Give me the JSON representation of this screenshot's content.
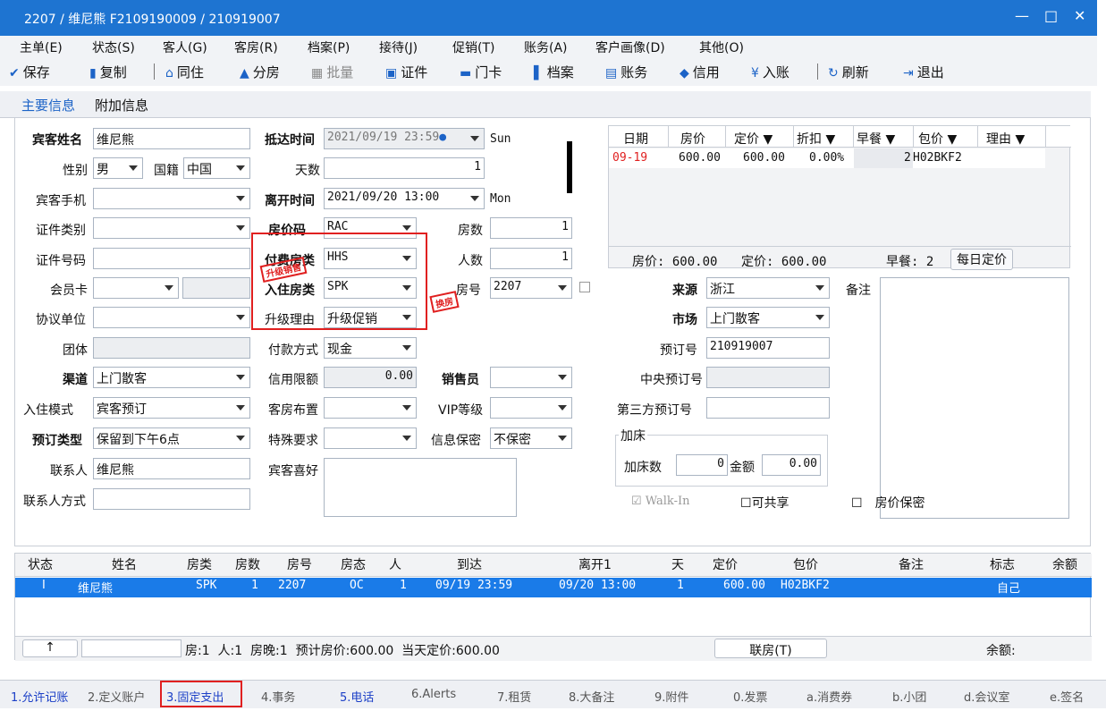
{
  "window": {
    "title": "2207 / 维尼熊 F2109190009 / 210919007",
    "min": "—",
    "max": "□",
    "close": "✕"
  },
  "menu": [
    "主单(E)",
    "状态(S)",
    "客人(G)",
    "客房(R)",
    "档案(P)",
    "接待(J)",
    "促销(T)",
    "账务(A)",
    "客户画像(D)",
    "其他(O)"
  ],
  "toolbar": {
    "save": "保存",
    "copy": "复制",
    "cohabit": "同住",
    "split": "分房",
    "batch": "批量",
    "cert": "证件",
    "card": "门卡",
    "archive": "档案",
    "account": "账务",
    "credit": "信用",
    "post": "入账",
    "refresh": "刷新",
    "exit": "退出"
  },
  "tabs": {
    "main": "主要信息",
    "extra": "附加信息"
  },
  "form": {
    "guest_name_label": "宾客姓名",
    "guest_name": "维尼熊",
    "gender_label": "性别",
    "gender": "男",
    "nationality_label": "国籍",
    "nationality": "中国",
    "mobile_label": "宾客手机",
    "id_type_label": "证件类别",
    "id_no_label": "证件号码",
    "member_label": "会员卡",
    "agreement_label": "协议单位",
    "group_label": "团体",
    "channel_label": "渠道",
    "channel": "上门散客",
    "checkin_mode_label": "入住模式",
    "checkin_mode": "宾客预订",
    "res_type_label": "预订类型",
    "res_type": "保留到下午6点",
    "contact_label": "联系人",
    "contact": "维尼熊",
    "contact_way_label": "联系人方式",
    "arrival_label": "抵达时间",
    "arrival": "2021/09/19 23:59",
    "arrival_day": "Sun",
    "days_label": "天数",
    "days": "1",
    "departure_label": "离开时间",
    "departure": "2021/09/20 13:00",
    "departure_day": "Mon",
    "rate_code_label": "房价码",
    "rate_code": "RAC",
    "rooms_label": "房数",
    "rooms": "1",
    "pay_type_label": "付费房类",
    "pay_type": "HHS",
    "persons_label": "人数",
    "persons": "1",
    "stay_type_label": "入住房类",
    "stay_type": "SPK",
    "room_no_label": "房号",
    "room_no": "2207",
    "upgrade_label": "升级理由",
    "upgrade": "升级促销",
    "pay_method_label": "付款方式",
    "pay_method": "现金",
    "credit_limit_label": "信用限额",
    "credit_limit": "0.00",
    "sales_label": "销售员",
    "layout_label": "客房布置",
    "vip_label": "VIP等级",
    "special_label": "特殊要求",
    "privacy_label": "信息保密",
    "privacy": "不保密",
    "pref_label": "宾客喜好",
    "stamp_upgrade": "升级销售",
    "stamp_change": "换房",
    "source_label": "来源",
    "source": "浙江",
    "market_label": "市场",
    "market": "上门散客",
    "res_no_label": "预订号",
    "res_no": "210919007",
    "central_label": "中央预订号",
    "third_label": "第三方预订号",
    "remark_label": "备注",
    "extrabed_label": "加床",
    "extrabed_count_label": "加床数",
    "extrabed_count": "0",
    "amount_label": "金额",
    "amount": "0.00",
    "walkin": "Walk-In",
    "shareable": "可共享",
    "rate_secret": "房价保密"
  },
  "rate_grid": {
    "headers": [
      "日期",
      "房价",
      "定价 ▼",
      "折扣 ▼",
      "早餐 ▼",
      "包价 ▼",
      "理由 ▼"
    ],
    "row": {
      "date": "09-19",
      "price": "600.00",
      "fixed": "600.00",
      "discount": "0.00%",
      "breakfast": "2",
      "package": "H02BKF2"
    },
    "summary_price": "房价: 600.00",
    "summary_fixed": "定价: 600.00",
    "summary_breakfast": "早餐: 2",
    "daily_btn": "每日定价"
  },
  "grid": {
    "headers": [
      "状态",
      "姓名",
      "房类",
      "房数",
      "房号",
      "房态",
      "人",
      "到达",
      "离开1",
      "天",
      "定价",
      "包价",
      "备注",
      "标志",
      "余额"
    ],
    "row": {
      "status": "I",
      "name": "维尼熊",
      "type": "SPK",
      "rooms": "1",
      "room": "2207",
      "state": "OC",
      "persons": "1",
      "arrival": "09/19 23:59",
      "departure": "09/20 13:00",
      "days": "1",
      "price": "600.00",
      "package": "H02BKF2",
      "flag": "自己"
    },
    "footer": {
      "up": "↑",
      "stats": "房:1  人:1  房晚:1  预计房价:600.00  当天定价:600.00",
      "link_btn": "联房(T)",
      "balance": "余额:"
    }
  },
  "bottom_tabs": [
    "1.允许记账",
    "2.定义账户",
    "3.固定支出",
    "4.事务",
    "5.电话",
    "6.Alerts",
    "7.租赁",
    "8.大备注",
    "9.附件",
    "0.发票",
    "a.消费券",
    "b.小团",
    "d.会议室",
    "e.签名"
  ],
  "colors": {
    "accent": "#1e74d1",
    "selection": "#1a7be8",
    "highlight": "#e02020"
  }
}
